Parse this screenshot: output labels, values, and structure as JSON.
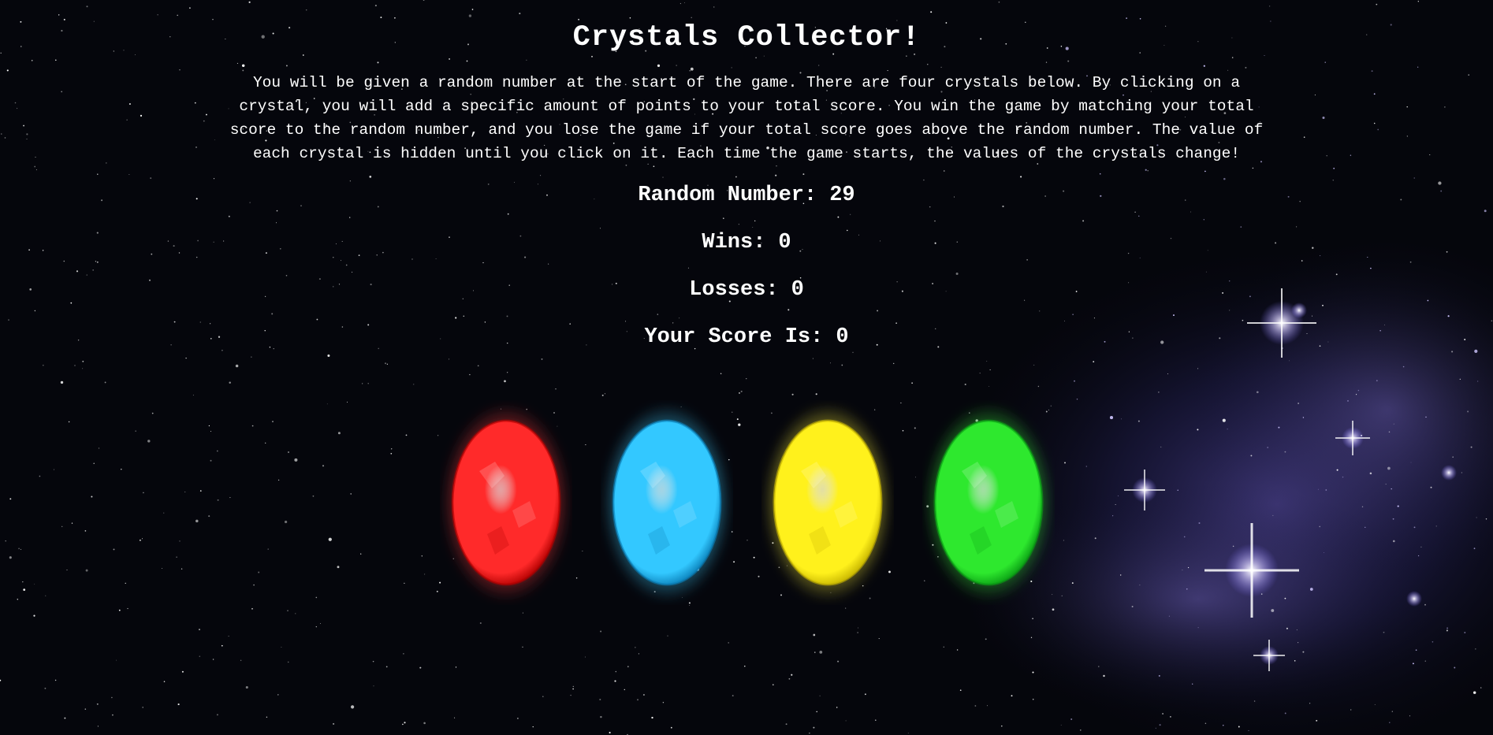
{
  "page": {
    "title": "Crystals Collector!",
    "instructions": "You will be given a random number at the start of the game. There are four crystals below. By clicking on a crystal, you will add a specific amount of points to your total score. You win the game by matching your total score to the random number, and you lose the game if your total score goes above the random number. The value of each crystal is hidden until you click on it. Each time the game starts, the values of the crystals change!"
  },
  "stats": {
    "random_label": "Random Number:",
    "random_value": "29",
    "wins_label": "Wins:",
    "wins_value": "0",
    "losses_label": "Losses:",
    "losses_value": "0",
    "score_label": "Your Score Is:",
    "score_value": "0"
  },
  "crystals": [
    {
      "name": "red-crystal-icon",
      "color": "#ff2a2a",
      "dark": "#b00000",
      "glow": "#ff3a3a"
    },
    {
      "name": "blue-crystal-icon",
      "color": "#33c8ff",
      "dark": "#0a7fb8",
      "glow": "#40d0ff"
    },
    {
      "name": "yellow-crystal-icon",
      "color": "#fff11c",
      "dark": "#c6b400",
      "glow": "#fff23a"
    },
    {
      "name": "green-crystal-icon",
      "color": "#2ee82e",
      "dark": "#0a9e14",
      "glow": "#3af03a"
    }
  ],
  "background": {
    "base_color": "#05060c",
    "nebula_color": "#5a4fb0"
  }
}
